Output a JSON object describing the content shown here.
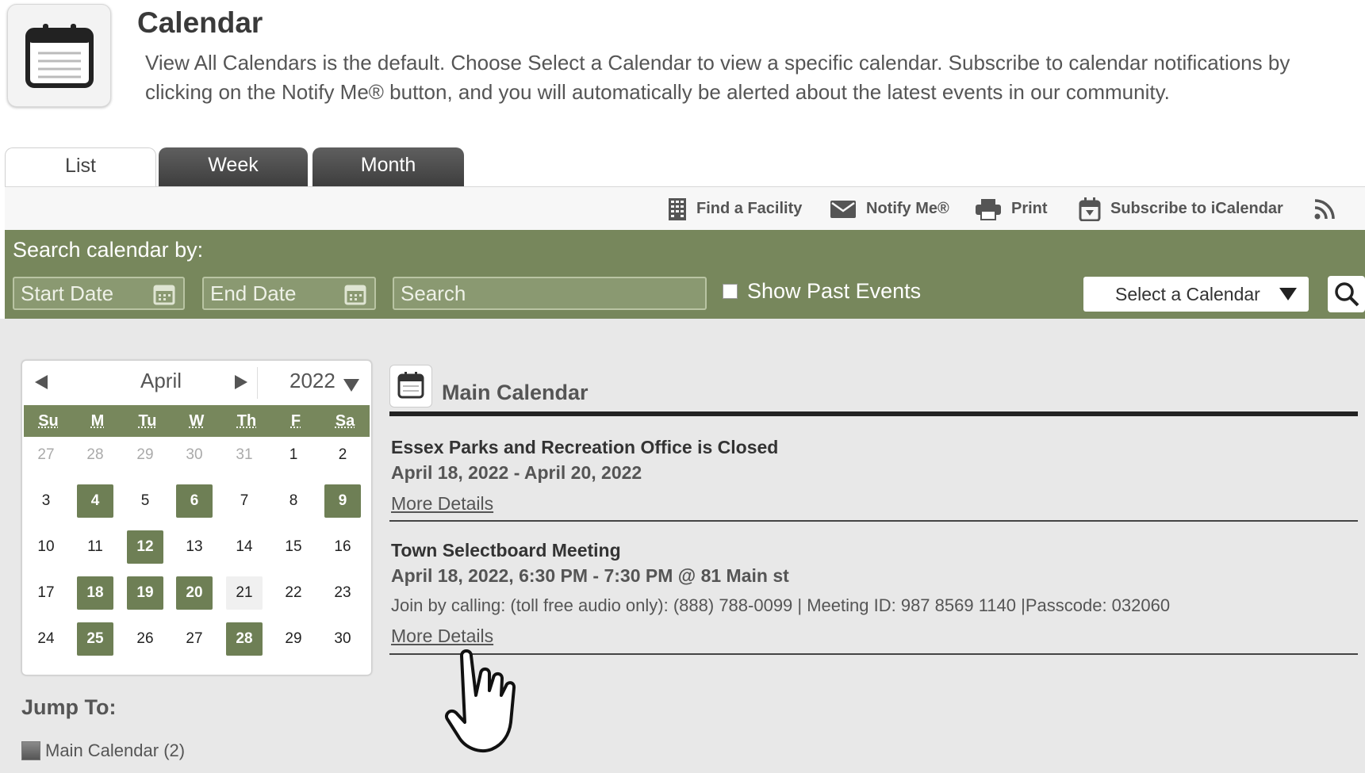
{
  "header": {
    "title": "Calendar",
    "description": "View All Calendars is the default. Choose Select a Calendar to view a specific calendar. Subscribe to calendar notifications by clicking on the Notify Me® button, and you will automatically be alerted about the latest events in our community."
  },
  "tabs": [
    {
      "label": "List",
      "active": true
    },
    {
      "label": "Week",
      "active": false
    },
    {
      "label": "Month",
      "active": false
    }
  ],
  "toolbar": {
    "find_facility": "Find a Facility",
    "notify_me": "Notify Me®",
    "print": "Print",
    "subscribe": "Subscribe to iCalendar",
    "rss_icon": "rss-icon"
  },
  "search": {
    "label": "Search calendar by:",
    "start_placeholder": "Start Date",
    "end_placeholder": "End Date",
    "search_placeholder": "Search",
    "show_past_label": "Show Past Events",
    "show_past_checked": false,
    "select_calendar": "Select a Calendar"
  },
  "mini_calendar": {
    "month": "April",
    "year": "2022",
    "weekdays": [
      "Su",
      "M",
      "Tu",
      "W",
      "Th",
      "F",
      "Sa"
    ],
    "weeks": [
      [
        "27",
        "28",
        "29",
        "30",
        "31",
        "1",
        "2"
      ],
      [
        "3",
        "4",
        "5",
        "6",
        "7",
        "8",
        "9"
      ],
      [
        "10",
        "11",
        "12",
        "13",
        "14",
        "15",
        "16"
      ],
      [
        "17",
        "18",
        "19",
        "20",
        "21",
        "22",
        "23"
      ],
      [
        "24",
        "25",
        "26",
        "27",
        "28",
        "29",
        "30"
      ]
    ],
    "event_days": [
      "4",
      "6",
      "9",
      "12",
      "18",
      "19",
      "20",
      "25",
      "28"
    ],
    "today": "21"
  },
  "jump": {
    "label": "Jump To:",
    "items": [
      {
        "label": "Main Calendar (2)"
      }
    ]
  },
  "main_calendar": {
    "title": "Main Calendar",
    "events": [
      {
        "title": "Essex Parks and Recreation Office is Closed",
        "date": "April 18, 2022 - April 20, 2022",
        "link": "More Details"
      },
      {
        "title": "Town Selectboard Meeting",
        "date": "April 18, 2022, 6:30 PM - 7:30 PM @ 81 Main st",
        "description": "Join by calling: (toll free audio only): (888) 788-0099 | Meeting ID: 987 8569 1140 |Passcode: 032060",
        "link": "More Details"
      }
    ]
  },
  "colors": {
    "accent_green": "#77875c",
    "event_day_green": "#6e7f55",
    "tab_dark": "#4a4a4a"
  }
}
